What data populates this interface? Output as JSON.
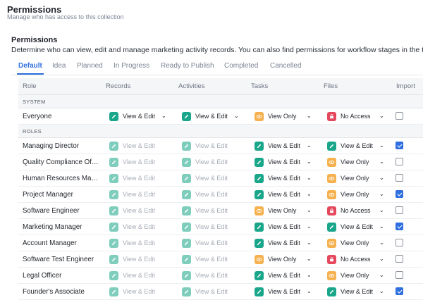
{
  "header": {
    "title": "Permissions",
    "subtitle": "Manage who has access to this collection"
  },
  "section": {
    "title": "Permissions",
    "description": "Determine who can view, edit and manage marketing activity records. You can also find permissions for workflow stages in the tabs."
  },
  "tabs": [
    "Default",
    "Idea",
    "Planned",
    "In Progress",
    "Ready to Publish",
    "Completed",
    "Cancelled"
  ],
  "active_tab": "Default",
  "columns": {
    "role": "Role",
    "records": "Records",
    "activities": "Activities",
    "tasks": "Tasks",
    "files": "Files",
    "import": "Import"
  },
  "groups": {
    "system": "SYSTEM",
    "roles": "ROLES"
  },
  "labels": {
    "edit": "View & Edit",
    "view": "View Only",
    "none": "No Access"
  },
  "system_rows": [
    {
      "role": "Everyone",
      "records": "edit",
      "activities": "edit",
      "tasks": "view",
      "files": "none",
      "import": false,
      "disabled": false
    }
  ],
  "role_rows": [
    {
      "role": "Managing Director",
      "records": "edit",
      "activities": "edit",
      "tasks": "edit",
      "files": "edit",
      "import": true,
      "disabled": true
    },
    {
      "role": "Quality Compliance Offi...",
      "records": "edit",
      "activities": "edit",
      "tasks": "edit",
      "files": "view",
      "import": false,
      "disabled": true
    },
    {
      "role": "Human Resources Mana...",
      "records": "edit",
      "activities": "edit",
      "tasks": "edit",
      "files": "view",
      "import": false,
      "disabled": true
    },
    {
      "role": "Project Manager",
      "records": "edit",
      "activities": "edit",
      "tasks": "edit",
      "files": "view",
      "import": true,
      "disabled": true
    },
    {
      "role": "Software Engineer",
      "records": "edit",
      "activities": "edit",
      "tasks": "view",
      "files": "none",
      "import": false,
      "disabled": true
    },
    {
      "role": "Marketing Manager",
      "records": "edit",
      "activities": "edit",
      "tasks": "edit",
      "files": "edit",
      "import": true,
      "disabled": true
    },
    {
      "role": "Account Manager",
      "records": "edit",
      "activities": "edit",
      "tasks": "edit",
      "files": "view",
      "import": false,
      "disabled": true
    },
    {
      "role": "Software Test Engineer",
      "records": "edit",
      "activities": "edit",
      "tasks": "view",
      "files": "none",
      "import": false,
      "disabled": true
    },
    {
      "role": "Legal Officer",
      "records": "edit",
      "activities": "edit",
      "tasks": "edit",
      "files": "view",
      "import": false,
      "disabled": true
    },
    {
      "role": "Founder's Associate",
      "records": "edit",
      "activities": "edit",
      "tasks": "edit",
      "files": "edit",
      "import": true,
      "disabled": true
    }
  ]
}
